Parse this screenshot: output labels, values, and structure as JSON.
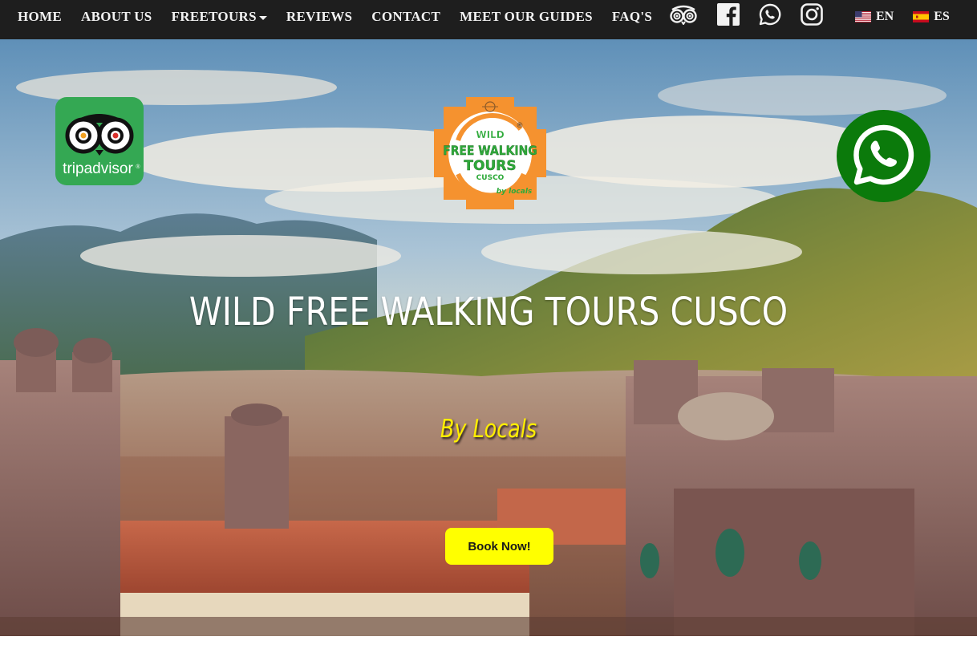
{
  "nav": {
    "items": [
      {
        "label": "HOME",
        "dropdown": false
      },
      {
        "label": "ABOUT US",
        "dropdown": false
      },
      {
        "label": "FREETOURS",
        "dropdown": true
      },
      {
        "label": "REVIEWS",
        "dropdown": false
      },
      {
        "label": "CONTACT",
        "dropdown": false
      },
      {
        "label": "MEET OUR GUIDES",
        "dropdown": false
      },
      {
        "label": "FAQ'S",
        "dropdown": false
      }
    ],
    "social_icons": [
      "tripadvisor-icon",
      "facebook-icon",
      "whatsapp-icon",
      "instagram-icon"
    ],
    "languages": [
      {
        "code": "EN",
        "flag": "us-flag-icon"
      },
      {
        "code": "ES",
        "flag": "spain-flag-icon"
      }
    ]
  },
  "hero": {
    "title": "WILD FREE WALKING TOURS CUSCO",
    "subtitle": "By Locals",
    "cta_label": "Book Now!",
    "logo": {
      "line1": "WILD",
      "line2": "FREE WALKING",
      "line3": "TOURS",
      "line4": "CUSCO",
      "tagline": "by locals",
      "registered": "®"
    },
    "tripadvisor_badge_text": "tripadvisor",
    "tripadvisor_registered": "®"
  },
  "colors": {
    "navbar_bg": "#1e1e1e",
    "nav_text": "#f2f2f2",
    "cta_bg": "#ffff00",
    "subtitle": "#ffee00",
    "tripadvisor_green": "#34a853",
    "whatsapp_green": "#0b7a0b",
    "logo_orange": "#f5922f",
    "logo_green": "#2eaa3a"
  }
}
